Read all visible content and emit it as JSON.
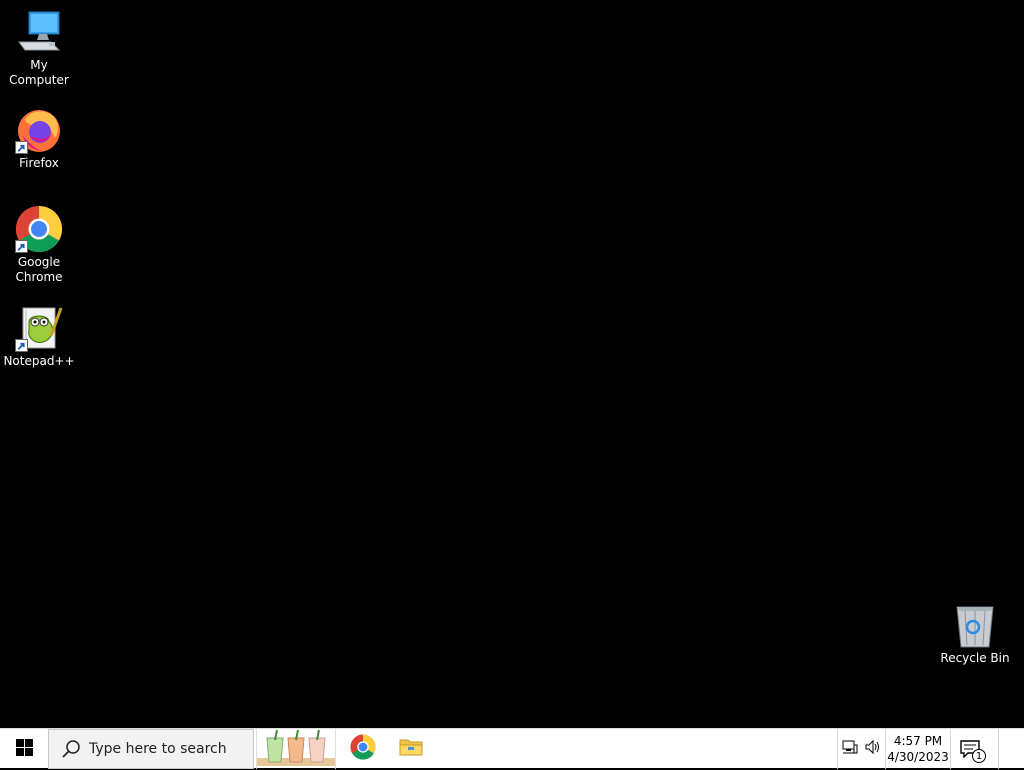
{
  "desktop": {
    "icons": [
      {
        "label": "My Computer",
        "icon": "computer-icon",
        "shortcut": false
      },
      {
        "label": "Firefox",
        "icon": "firefox-icon",
        "shortcut": true
      },
      {
        "label": "Google Chrome",
        "icon": "chrome-icon",
        "shortcut": true
      },
      {
        "label": "Notepad++",
        "icon": "notepadpp-icon",
        "shortcut": true
      },
      {
        "label": "Recycle Bin",
        "icon": "recycle-bin-icon",
        "shortcut": false
      }
    ],
    "background": "#000000"
  },
  "taskbar": {
    "start_icon": "windows-logo-icon",
    "search_placeholder": "Type here to search",
    "pinned": [
      {
        "icon": "bubble-tea-icon"
      },
      {
        "icon": "chrome-icon"
      },
      {
        "icon": "file-explorer-icon"
      }
    ],
    "tray": {
      "network_icon": "network-icon",
      "volume_icon": "volume-icon",
      "time": "4:57 PM",
      "date": "4/30/2023",
      "notifications_count": "1"
    }
  }
}
